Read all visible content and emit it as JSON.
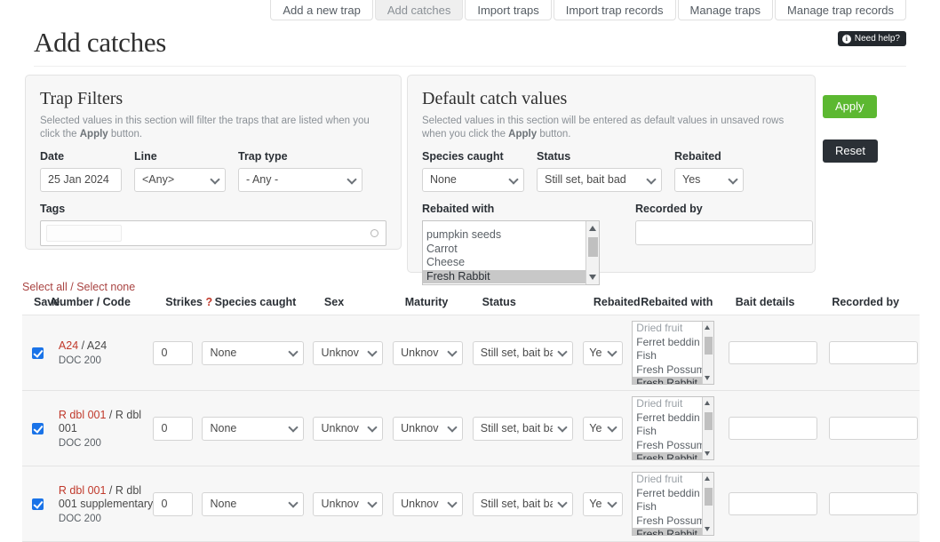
{
  "tabs": [
    {
      "label": "Add a new trap",
      "active": false
    },
    {
      "label": "Add catches",
      "active": true
    },
    {
      "label": "Import traps",
      "active": false
    },
    {
      "label": "Import trap records",
      "active": false
    },
    {
      "label": "Manage traps",
      "active": false
    },
    {
      "label": "Manage trap records",
      "active": false
    }
  ],
  "header": {
    "title": "Add catches",
    "help_label": "Need help?",
    "help_icon": "info-icon"
  },
  "trap_filters": {
    "title": "Trap Filters",
    "description_pre": "Selected values in this section will filter the traps that are listed when you click the ",
    "description_bold": "Apply",
    "description_post": " button.",
    "date": {
      "label": "Date",
      "value": "25 Jan 2024"
    },
    "line": {
      "label": "Line",
      "value": "<Any>"
    },
    "trap_type": {
      "label": "Trap type",
      "value": "- Any -"
    },
    "tags": {
      "label": "Tags",
      "value": ""
    }
  },
  "default_catch_values": {
    "title": "Default catch values",
    "description_pre": "Selected values in this section will be entered as default values in unsaved rows when you click the ",
    "description_bold": "Apply",
    "description_post": " button.",
    "species_caught": {
      "label": "Species caught",
      "value": "None"
    },
    "status": {
      "label": "Status",
      "value": "Still set, bait bad"
    },
    "rebaited": {
      "label": "Rebaited",
      "value": "Yes"
    },
    "rebaited_with": {
      "label": "Rebaited with",
      "options": [
        "pumpkin seeds",
        "Carrot",
        "Cheese",
        "Fresh Rabbit"
      ],
      "selected": "Fresh Rabbit"
    },
    "recorded_by": {
      "label": "Recorded by",
      "value": ""
    }
  },
  "side_buttons": {
    "apply": "Apply",
    "reset": "Reset",
    "apply_color": "#5cb831",
    "reset_color": "#2b3036"
  },
  "selection_links": {
    "select_all": "Select all",
    "separator": "/",
    "select_none": "Select none",
    "link_color": "#a94442"
  },
  "table": {
    "headers": {
      "save": "Save",
      "number_code": "Number / Code",
      "strikes": "Strikes",
      "strikes_help": "?",
      "species_caught": "Species caught",
      "sex": "Sex",
      "maturity": "Maturity",
      "status": "Status",
      "rebaited": "Rebaited",
      "rebaited_with": "Rebaited with",
      "bait_details": "Bait details",
      "recorded_by": "Recorded by"
    },
    "listbox_options": [
      "Dried fruit",
      "Ferret beddin",
      "Fish",
      "Fresh Possum",
      "Fresh Rabbit"
    ],
    "listbox_selected": "Fresh Rabbit",
    "rows": [
      {
        "checked": true,
        "code": "A24",
        "name": "A24",
        "trap_type": "DOC 200",
        "strikes": "0",
        "species_caught": "None",
        "sex": "Unknov",
        "maturity": "Unknov",
        "status": "Still set, bait ba",
        "rebaited": "Ye",
        "bait_details": "",
        "recorded_by": ""
      },
      {
        "checked": true,
        "code": "R dbl 001",
        "name": "R dbl 001",
        "trap_type": "DOC 200",
        "strikes": "0",
        "species_caught": "None",
        "sex": "Unknov",
        "maturity": "Unknov",
        "status": "Still set, bait ba",
        "rebaited": "Ye",
        "bait_details": "",
        "recorded_by": ""
      },
      {
        "checked": true,
        "code": "R dbl 001",
        "name": "R dbl 001 supplementary",
        "trap_type": "DOC 200",
        "strikes": "0",
        "species_caught": "None",
        "sex": "Unknov",
        "maturity": "Unknov",
        "status": "Still set, bait ba",
        "rebaited": "Ye",
        "bait_details": "",
        "recorded_by": ""
      }
    ]
  }
}
